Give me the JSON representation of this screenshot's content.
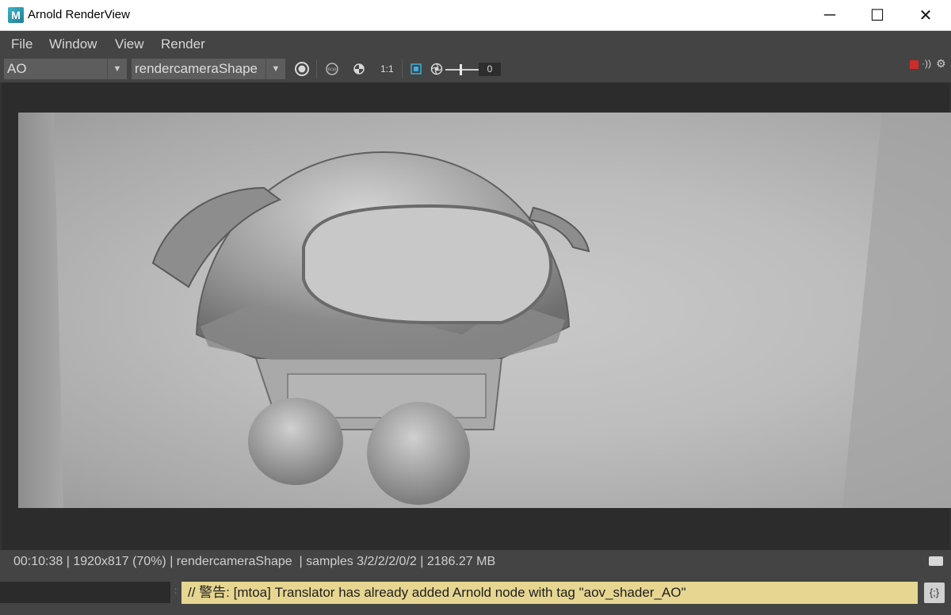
{
  "window": {
    "title": "Arnold RenderView",
    "logo_letter": "M",
    "controls": {
      "minimize": "─",
      "maximize": "☐",
      "close": "✕"
    }
  },
  "menu": {
    "items": [
      {
        "label": "File"
      },
      {
        "label": "Window"
      },
      {
        "label": "View"
      },
      {
        "label": "Render"
      }
    ]
  },
  "toolbar": {
    "aov_select": "AO",
    "camera_select": "rendercameraShape",
    "ratio_label": "1:1",
    "exposure_value": "0",
    "stop_color": "#cf2b2b"
  },
  "status": {
    "text": "00:10:38 | 1920x817 (70%) | rendercameraShape  | samples 3/2/2/2/0/2 | 2186.27 MB"
  },
  "command_line": {
    "warning": "// 警告: [mtoa] Translator has already added Arnold node with tag \"aov_shader_AO\"",
    "warning_bg": "#e6d691",
    "script_editor_glyph": "{;}"
  },
  "icons": [
    "render-icon",
    "rgb-channel-icon",
    "isolate-icon",
    "crop-region-icon",
    "exposure-icon",
    "stop-render-icon",
    "speaker-icon",
    "gear-icon",
    "snapshot-icon"
  ]
}
